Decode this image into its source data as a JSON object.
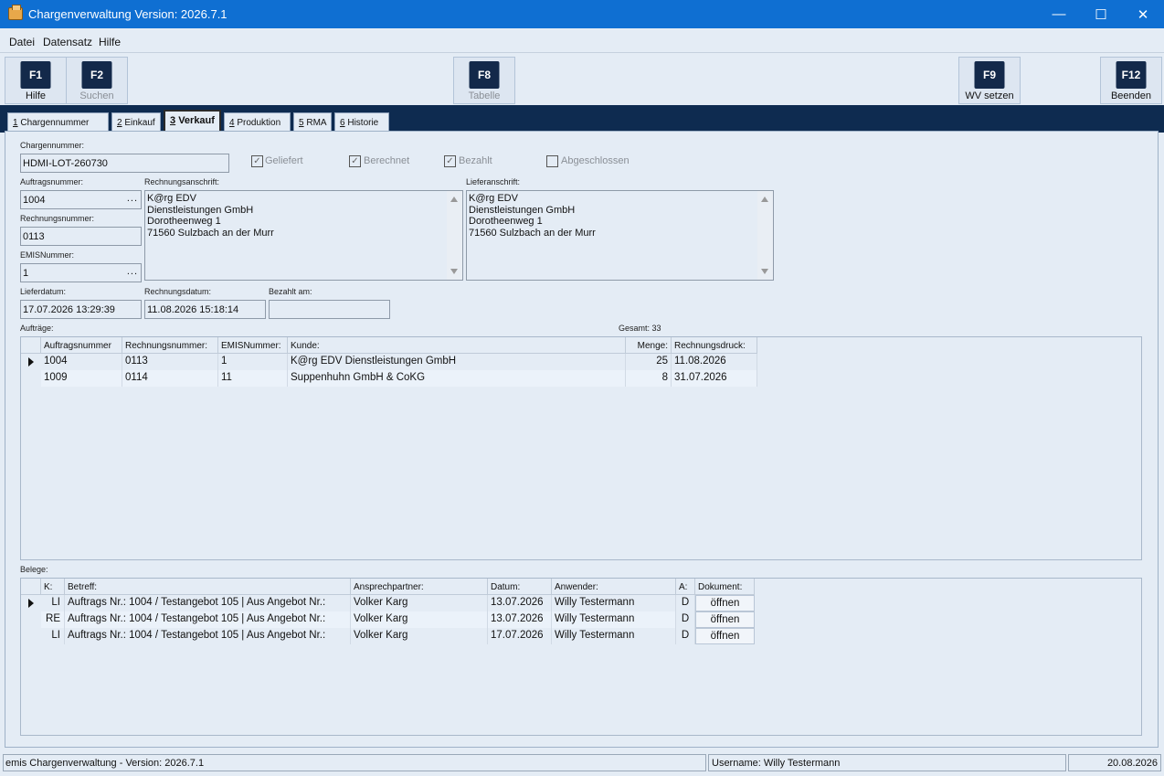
{
  "window": {
    "title": "Chargenverwaltung Version: 2026.7.1",
    "minimize_glyph": "—",
    "maximize_glyph": "☐",
    "close_glyph": "✕"
  },
  "menu": [
    "Datei",
    "Datensatz",
    "Hilfe"
  ],
  "toolbar": [
    {
      "key": "F1",
      "label": "Hilfe",
      "enabled": true
    },
    {
      "key": "F2",
      "label": "Suchen",
      "enabled": false
    },
    {
      "key": "F8",
      "label": "Tabelle",
      "enabled": false
    },
    {
      "key": "F9",
      "label": "WV setzen",
      "enabled": true
    },
    {
      "key": "F12",
      "label": "Beenden",
      "enabled": true
    }
  ],
  "tabs": [
    {
      "num": "1",
      "label": "Chargennummer"
    },
    {
      "num": "2",
      "label": "Einkauf"
    },
    {
      "num": "3",
      "label": "Verkauf",
      "active": true
    },
    {
      "num": "4",
      "label": "Produktion"
    },
    {
      "num": "5",
      "label": "RMA"
    },
    {
      "num": "6",
      "label": "Historie"
    }
  ],
  "form": {
    "chargennummer_label": "Chargennummer:",
    "chargennummer": "HDMI-LOT-260730",
    "checkboxes": [
      {
        "label": "Geliefert",
        "checked": true
      },
      {
        "label": "Berechnet",
        "checked": true
      },
      {
        "label": "Bezahlt",
        "checked": true
      },
      {
        "label": "Abgeschlossen",
        "checked": false
      }
    ],
    "auftragsnummer_label": "Auftragsnummer:",
    "auftragsnummer": "1004",
    "rechnungsnummer_label": "Rechnungsnummer:",
    "rechnungsnummer": "0113",
    "emisnummer_label": "EMISNummer:",
    "emisnummer": "1",
    "ellipsis": "...",
    "rechnungsanschrift_label": "Rechnungsanschrift:",
    "rechnungsanschrift": [
      "K@rg EDV",
      "Dienstleistungen GmbH",
      "Dorotheenweg 1",
      "71560 Sulzbach an der Murr"
    ],
    "lieferanschrift_label": "Lieferanschrift:",
    "lieferanschrift": [
      "K@rg EDV",
      "Dienstleistungen GmbH",
      "Dorotheenweg 1",
      "71560 Sulzbach an der Murr"
    ],
    "lieferdatum_label": "Lieferdatum:",
    "lieferdatum": "17.07.2026 13:29:39",
    "rechnungsdatum_label": "Rechnungsdatum:",
    "rechnungsdatum": "11.08.2026 15:18:14",
    "bezahlt_am_label": "Bezahlt am:",
    "bezahlt_am": ""
  },
  "auftraege": {
    "label": "Aufträge:",
    "total": "Gesamt: 33",
    "columns": [
      "Auftragsnummer",
      "Rechnungsnummer:",
      "EMISNummer:",
      "Kunde:",
      "Menge:",
      "Rechnungsdruck:"
    ],
    "rows": [
      {
        "auftrag": "1004",
        "rechnung": "0113",
        "emis": "1",
        "kunde": "K@rg EDV Dienstleistungen GmbH",
        "menge": "25",
        "druck": "11.08.2026",
        "selected": true
      },
      {
        "auftrag": "1009",
        "rechnung": "0114",
        "emis": "11",
        "kunde": "Suppenhuhn GmbH & CoKG",
        "menge": "8",
        "druck": "31.07.2026",
        "selected": false
      }
    ]
  },
  "belege": {
    "label": "Belege:",
    "columns": [
      "K:",
      "Betreff:",
      "Ansprechpartner:",
      "Datum:",
      "Anwender:",
      "A:",
      "Dokument:"
    ],
    "rows": [
      {
        "k": "LI",
        "betreff": "Auftrags Nr.: 1004 / Testangebot 105 | Aus Angebot Nr.:",
        "partner": "Volker Karg",
        "datum": "13.07.2026",
        "anwender": "Willy Testermann",
        "a": "D",
        "dok": "öffnen",
        "selected": true
      },
      {
        "k": "RE",
        "betreff": "Auftrags Nr.: 1004 / Testangebot 105 | Aus Angebot Nr.:",
        "partner": "Volker Karg",
        "datum": "13.07.2026",
        "anwender": "Willy Testermann",
        "a": "D",
        "dok": "öffnen",
        "selected": false
      },
      {
        "k": "LI",
        "betreff": "Auftrags Nr.: 1004 / Testangebot 105 | Aus Angebot Nr.:",
        "partner": "Volker Karg",
        "datum": "17.07.2026",
        "anwender": "Willy Testermann",
        "a": "D",
        "dok": "öffnen",
        "selected": false
      }
    ]
  },
  "statusbar": {
    "app": "emis Chargenverwaltung - Version: 2026.7.1",
    "user": "Username: Willy Testermann",
    "date": "20.08.2026"
  }
}
